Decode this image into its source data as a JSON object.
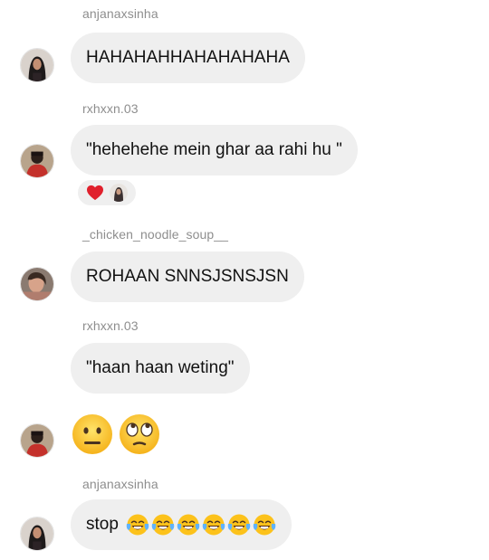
{
  "messages": [
    {
      "username": "anjanaxsinha",
      "text": "HAHAHAHHAHAHAHAHA"
    },
    {
      "username": "rxhxxn.03",
      "text": "\"hehehehe mein ghar aa rahi hu \""
    },
    {
      "username": "_chicken_noodle_soup__",
      "text": "ROHAAN SNNSJSNSJSN"
    },
    {
      "username": "rxhxxn.03",
      "text": "\"haan haan weting\""
    },
    {
      "username": "anjanaxsinha",
      "text": "stop"
    }
  ],
  "reactions": {
    "icons": [
      "red-heart-icon",
      "reactor-avatar"
    ]
  },
  "emoji_message": {
    "icons": [
      "neutral-face-icon",
      "eye-roll-face-icon"
    ]
  },
  "stop_message_emojis": [
    "tears-of-joy-icon",
    "tears-of-joy-icon",
    "tears-of-joy-icon",
    "tears-of-joy-icon",
    "tears-of-joy-icon",
    "tears-of-joy-icon"
  ],
  "colors": {
    "bubble": "#efefef",
    "username": "#8e8e8e",
    "heart": "#e0202c"
  }
}
